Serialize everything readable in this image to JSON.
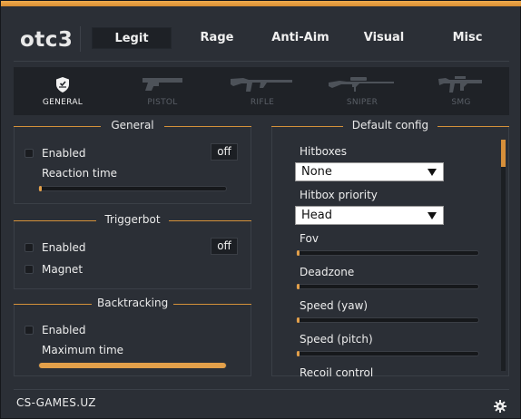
{
  "app": {
    "logo": "otc3",
    "accent": "#e3a04a"
  },
  "tabs": [
    {
      "label": "Legit",
      "active": true
    },
    {
      "label": "Rage"
    },
    {
      "label": "Anti-Aim"
    },
    {
      "label": "Visual"
    },
    {
      "label": "Misc"
    }
  ],
  "weapon_tabs": [
    {
      "label": "GENERAL",
      "icon": "shield-icon",
      "active": true
    },
    {
      "label": "PISTOL",
      "icon": "pistol-icon"
    },
    {
      "label": "RIFLE",
      "icon": "rifle-icon"
    },
    {
      "label": "SNIPER",
      "icon": "sniper-icon"
    },
    {
      "label": "SMG",
      "icon": "smg-icon"
    }
  ],
  "general": {
    "title": "General",
    "enabled_label": "Enabled",
    "enabled_key": "off",
    "reaction_time_label": "Reaction time",
    "reaction_time_value": 0
  },
  "triggerbot": {
    "title": "Triggerbot",
    "enabled_label": "Enabled",
    "enabled_key": "off",
    "magnet_label": "Magnet"
  },
  "backtracking": {
    "title": "Backtracking",
    "enabled_label": "Enabled",
    "max_time_label": "Maximum time",
    "max_time_value": 1.0
  },
  "default_config": {
    "title": "Default config",
    "hitboxes_label": "Hitboxes",
    "hitboxes_value": "None",
    "hitbox_priority_label": "Hitbox priority",
    "hitbox_priority_value": "Head",
    "fov_label": "Fov",
    "deadzone_label": "Deadzone",
    "speed_yaw_label": "Speed (yaw)",
    "speed_pitch_label": "Speed (pitch)",
    "recoil_label": "Recoil control"
  },
  "footer": {
    "text": "CS-GAMES.UZ",
    "icon": "gear-icon"
  }
}
